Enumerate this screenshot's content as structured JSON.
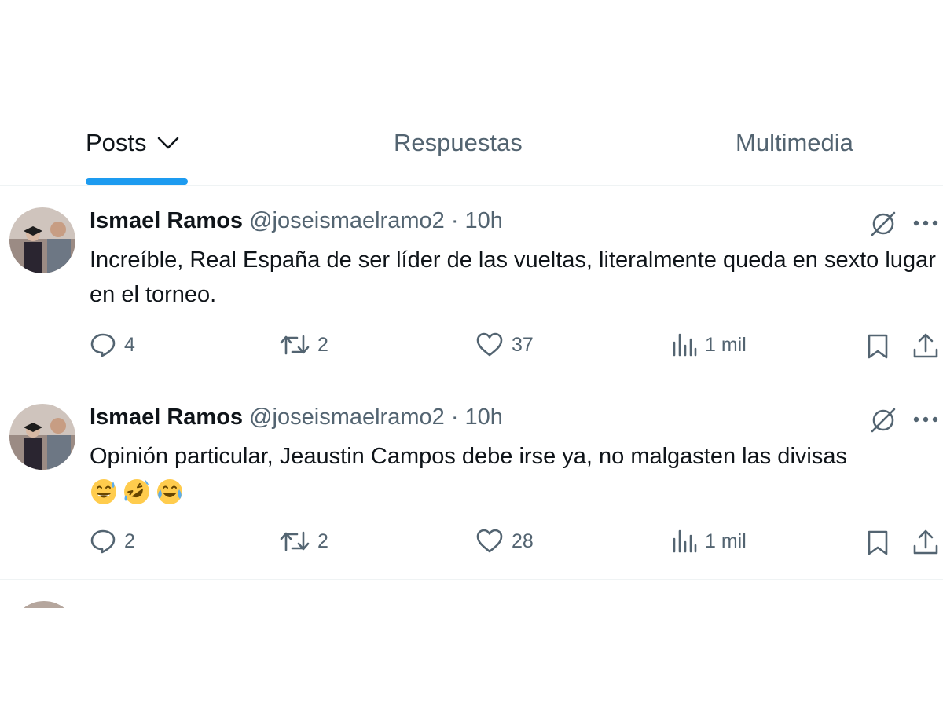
{
  "tabs": [
    {
      "label": "Posts",
      "active": true
    },
    {
      "label": "Respuestas",
      "active": false
    },
    {
      "label": "Multimedia",
      "active": false
    }
  ],
  "colors": {
    "accent": "#1d9bf0",
    "text": "#0f1419",
    "secondary": "#536471"
  },
  "posts": [
    {
      "name": "Ismael Ramos",
      "handle": "@joseismaelramo2",
      "separator": "·",
      "time": "10h",
      "text": "Increíble, Real España de ser líder de las vueltas, literalmente queda en sexto lugar en el torneo.",
      "emojis": [],
      "replies": "4",
      "reposts": "2",
      "likes": "37",
      "views": "1 mil"
    },
    {
      "name": "Ismael Ramos",
      "handle": "@joseismaelramo2",
      "separator": "·",
      "time": "10h",
      "text": "Opinión particular, Jeaustin Campos debe irse ya, no malgasten las divisas",
      "emojis": [
        "grinning-face-with-sweat",
        "rolling-on-the-floor-laughing",
        "face-with-tears-of-joy"
      ],
      "replies": "2",
      "reposts": "2",
      "likes": "28",
      "views": "1 mil"
    }
  ]
}
